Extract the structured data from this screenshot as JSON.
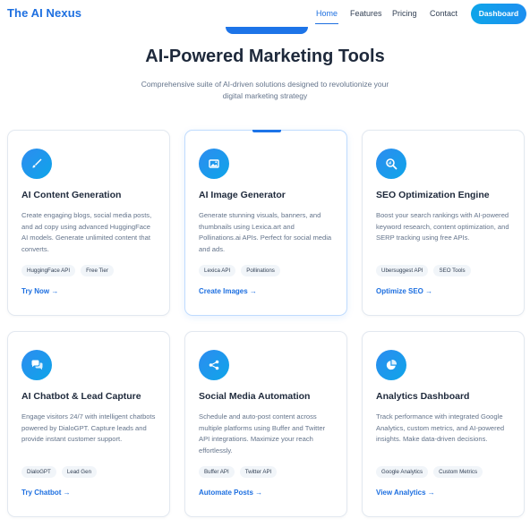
{
  "nav": {
    "brand": "The AI Nexus",
    "links": [
      "Home",
      "Features",
      "Pricing",
      "Contact"
    ],
    "active": "Home",
    "cta": "Dashboard"
  },
  "hero": {
    "title": "AI-Powered Marketing Tools",
    "subtitle": "Comprehensive suite of AI-driven solutions designed to revolutionize your digital marketing strategy"
  },
  "colors": {
    "accent": "#1d6fe0",
    "accent_gradient_start": "#2d8cf0",
    "accent_gradient_end": "#0ea5e9",
    "text": "#1e293b",
    "muted": "#64748b",
    "tag_bg": "#f1f5f9"
  },
  "cards": [
    {
      "icon": "brush-icon",
      "title": "AI Content Generation",
      "description": "Create engaging blogs, social media posts, and ad copy using advanced HuggingFace AI models. Generate unlimited content that converts.",
      "tags": [
        "HuggingFace API",
        "Free Tier"
      ],
      "link": "Try Now →"
    },
    {
      "icon": "image-icon",
      "title": "AI Image Generator",
      "description": "Generate stunning visuals, banners, and thumbnails using Lexica.art and Pollinations.ai APIs. Perfect for social media and ads.",
      "tags": [
        "Lexica API",
        "Pollinations"
      ],
      "link": "Create Images →"
    },
    {
      "icon": "search-chart-icon",
      "title": "SEO Optimization Engine",
      "description": "Boost your search rankings with AI-powered keyword research, content optimization, and SERP tracking using free APIs.",
      "tags": [
        "Ubersuggest API",
        "SEO Tools"
      ],
      "link": "Optimize SEO →"
    },
    {
      "icon": "chat-bubbles-icon",
      "title": "AI Chatbot & Lead Capture",
      "description": "Engage visitors 24/7 with intelligent chatbots powered by DialoGPT. Capture leads and provide instant customer support.",
      "tags": [
        "DialoGPT",
        "Lead Gen"
      ],
      "link": "Try Chatbot →"
    },
    {
      "icon": "share-icon",
      "title": "Social Media Automation",
      "description": "Schedule and auto-post content across multiple platforms using Buffer and Twitter API integrations. Maximize your reach effortlessly.",
      "tags": [
        "Buffer API",
        "Twitter API"
      ],
      "link": "Automate Posts →"
    },
    {
      "icon": "pie-chart-icon",
      "title": "Analytics Dashboard",
      "description": "Track performance with integrated Google Analytics, custom metrics, and AI-powered insights. Make data-driven decisions.",
      "tags": [
        "Google Analytics",
        "Custom Metrics"
      ],
      "link": "View Analytics →"
    }
  ]
}
